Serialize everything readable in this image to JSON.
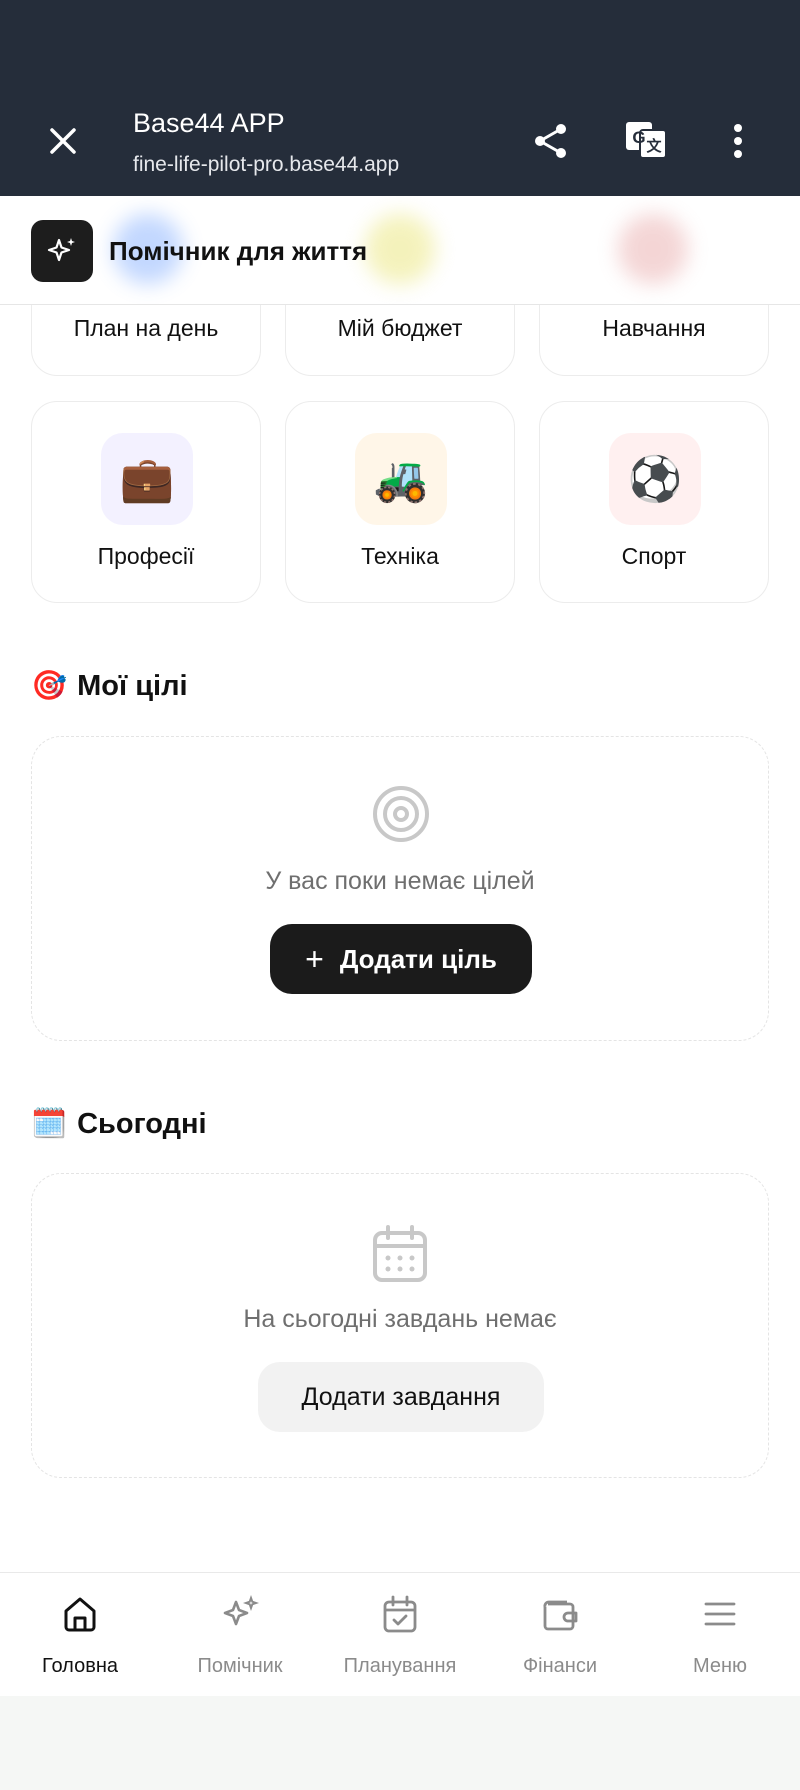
{
  "browser": {
    "title": "Base44 APP",
    "url": "fine-life-pilot-pro.base44.app",
    "icons": [
      "close-icon",
      "share-icon",
      "translate-icon",
      "more-vertical-icon"
    ]
  },
  "header": {
    "title": "Помічник для життя",
    "logo_icon": "sparkles-icon"
  },
  "categories": [
    {
      "label": "План на день",
      "icon": "calendar"
    },
    {
      "label": "Мій бюджет",
      "icon": "wallet"
    },
    {
      "label": "Навчання",
      "icon": "book"
    },
    {
      "label": "Професії",
      "icon": "briefcase",
      "emoji": "💼",
      "bg": "#f3f1ff"
    },
    {
      "label": "Техніка",
      "icon": "tractor",
      "emoji": "🚜",
      "bg": "#fff6e8"
    },
    {
      "label": "Спорт",
      "icon": "soccer-ball",
      "emoji": "⚽",
      "bg": "#fff0f0"
    }
  ],
  "goals": {
    "emoji": "🎯",
    "title": "Мої цілі",
    "empty_text": "У вас поки немає цілей",
    "add_button": "Додати ціль",
    "plus": "+"
  },
  "today": {
    "emoji": "🗓️",
    "title": "Сьогодні",
    "empty_text": "На сьогодні завдань немає",
    "add_button": "Додати завдання"
  },
  "nav": {
    "items": [
      {
        "label": "Головна",
        "icon": "home-icon",
        "active": true
      },
      {
        "label": "Помічник",
        "icon": "sparkles-icon",
        "active": false
      },
      {
        "label": "Планування",
        "icon": "calendar-check-icon",
        "active": false
      },
      {
        "label": "Фінанси",
        "icon": "wallet-icon",
        "active": false
      },
      {
        "label": "Меню",
        "icon": "menu-icon",
        "active": false
      }
    ]
  },
  "colors": {
    "topbar": "#252d3a",
    "primary": "#1b1b1b",
    "muted": "#8b8b8b"
  }
}
